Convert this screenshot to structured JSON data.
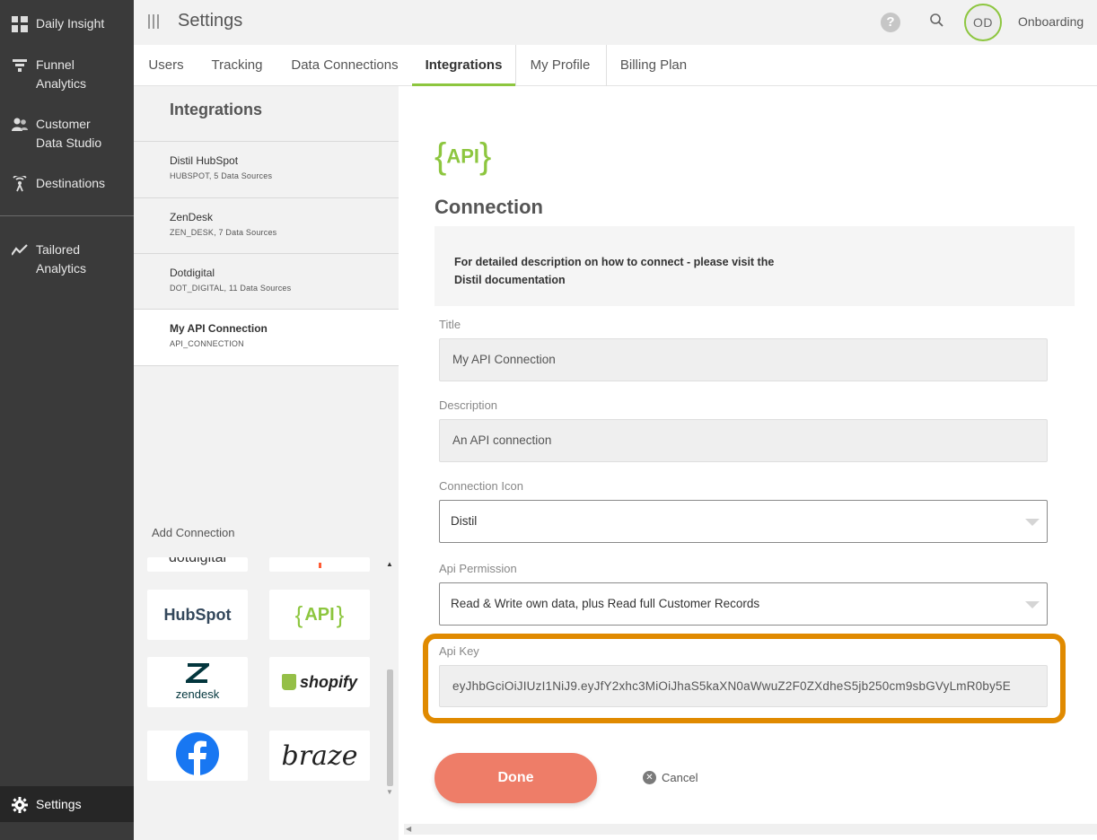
{
  "nav": {
    "items": [
      {
        "label": "Daily Insight",
        "icon": "grid-icon"
      },
      {
        "label": "Funnel Analytics",
        "line1": "Funnel",
        "line2": "Analytics",
        "icon": "funnel-icon"
      },
      {
        "label": "Customer Data Studio",
        "line1": "Customer",
        "line2": "Data Studio",
        "icon": "users-icon"
      },
      {
        "label": "Destinations",
        "icon": "broadcast-icon"
      },
      {
        "label": "Tailored Analytics",
        "line1": "Tailored",
        "line2": "Analytics",
        "icon": "trend-icon"
      }
    ],
    "settings_label": "Settings"
  },
  "header": {
    "title": "Settings",
    "avatar_initials": "OD",
    "user_name": "Onboarding",
    "help_glyph": "?"
  },
  "tabs": [
    {
      "label": "Users"
    },
    {
      "label": "Tracking"
    },
    {
      "label": "Data Connections"
    },
    {
      "label": "Integrations",
      "active": true
    },
    {
      "label": "My Profile"
    },
    {
      "label": "Billing Plan"
    }
  ],
  "integrations": {
    "title": "Integrations",
    "items": [
      {
        "name": "Distil HubSpot",
        "sub": "HUBSPOT, 5 Data Sources"
      },
      {
        "name": "ZenDesk",
        "sub": "ZEN_DESK, 7 Data Sources"
      },
      {
        "name": "Dotdigital",
        "sub": "DOT_DIGITAL, 11 Data Sources"
      },
      {
        "name": "My API Connection",
        "sub": "API_CONNECTION",
        "selected": true
      }
    ],
    "add_connection_label": "Add Connection",
    "logos": {
      "partial_left": "dotdigital",
      "hubspot": "HubSpot",
      "api": "API",
      "zendesk": "zendesk",
      "shopify": "shopify",
      "braze": "braze"
    }
  },
  "detail": {
    "logo_text": "API",
    "title": "Connection",
    "info_text": "For detailed description on how to connect - please visit the Distil documentation",
    "fields": {
      "title_label": "Title",
      "title_value": "My API Connection",
      "description_label": "Description",
      "description_value": "An API connection",
      "icon_label": "Connection Icon",
      "icon_value": "Distil",
      "permission_label": "Api Permission",
      "permission_value": "Read & Write own data, plus Read full Customer Records",
      "apikey_label": "Api Key",
      "apikey_value": "eyJhbGciOiJIUzI1NiJ9.eyJfY2xhc3MiOiJhaS5kaXN0aWwuZ2F0ZXdheS5jb250cm9sbGVyLmR0by5E"
    },
    "done_label": "Done",
    "cancel_label": "Cancel"
  },
  "colors": {
    "accent_green": "#8dc63f",
    "done_button": "#ee7d68",
    "highlight_orange": "#e08a00",
    "sidebar_bg": "#3a3a3a"
  }
}
